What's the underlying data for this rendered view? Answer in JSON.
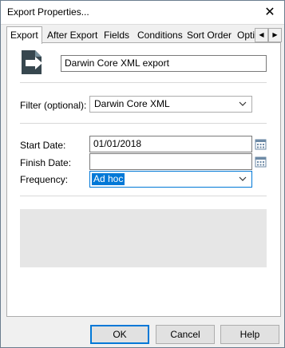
{
  "window": {
    "title": "Export Properties..."
  },
  "tabs": [
    {
      "label": "Export",
      "active": true
    },
    {
      "label": "After Export",
      "active": false
    },
    {
      "label": "Fields",
      "active": false
    },
    {
      "label": "Conditions",
      "active": false
    },
    {
      "label": "Sort Order",
      "active": false
    },
    {
      "label": "Opti",
      "active": false
    }
  ],
  "export_tab": {
    "export_name": "Darwin Core XML export",
    "filter": {
      "label": "Filter (optional):",
      "value": "Darwin Core XML"
    },
    "start_date": {
      "label": "Start Date:",
      "value": "01/01/2018"
    },
    "finish_date": {
      "label": "Finish Date:",
      "value": ""
    },
    "frequency": {
      "label": "Frequency:",
      "value": "Ad hoc"
    }
  },
  "buttons": {
    "ok": "OK",
    "cancel": "Cancel",
    "help": "Help"
  },
  "icons": {
    "close": "close-icon",
    "export": "export-icon",
    "calendar": "calendar-icon",
    "tab_left": "chevron-left-icon",
    "tab_right": "chevron-right-icon",
    "dropdown": "chevron-down-icon"
  },
  "colors": {
    "accent": "#0078d7",
    "icon_dark": "#37474f",
    "info_area": "#e6e6e6"
  }
}
